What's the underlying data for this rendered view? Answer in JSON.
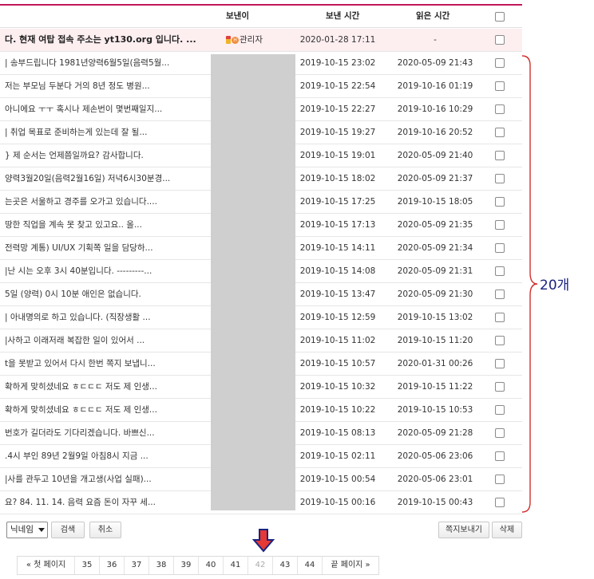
{
  "header": {
    "sender": "보낸이",
    "sent_time": "보낸 시간",
    "read_time": "읽은 시간"
  },
  "notice": {
    "subject": "다. 현재 여탑 접속 주소는 yt130.org 입니다. ...",
    "sender": "관리자",
    "sent": "2020-01-28 17:11",
    "read": "-"
  },
  "messages": [
    {
      "subject": "| 송부드립니다 1981년양력6월5일(음력5월...",
      "sent": "2019-10-15 23:02",
      "read": "2020-05-09 21:43"
    },
    {
      "subject": "저는 부모님 두분다 거의 8년 정도 병원...",
      "sent": "2019-10-15 22:54",
      "read": "2019-10-16 01:19"
    },
    {
      "subject": "아니에요 ㅜㅜ 혹시나 제손번이 몇번째일지...",
      "sent": "2019-10-15 22:27",
      "read": "2019-10-16 10:29"
    },
    {
      "subject": "| 취업 목표로 준비하는게 있는데 잘 될...",
      "sent": "2019-10-15 19:27",
      "read": "2019-10-16 20:52"
    },
    {
      "subject": "} 제 순서는 언제쯤일까요? 감사합니다.",
      "sent": "2019-10-15 19:01",
      "read": "2020-05-09 21:40"
    },
    {
      "subject": "양력3월20일(음력2월16일) 저녁6시30분경...",
      "sent": "2019-10-15 18:02",
      "read": "2020-05-09 21:37"
    },
    {
      "subject": "는곳은 서울하고 경주를 오가고 있습니다....",
      "sent": "2019-10-15 17:25",
      "read": "2019-10-15 18:05"
    },
    {
      "subject": "땅한 직업을 계속 못 찾고 있고요.. 올...",
      "sent": "2019-10-15 17:13",
      "read": "2020-05-09 21:35"
    },
    {
      "subject": "전력망 계통) UI/UX 기획쪽 일을 담당하...",
      "sent": "2019-10-15 14:11",
      "read": "2020-05-09 21:34"
    },
    {
      "subject": "|난 시는 오후 3시 40분입니다. ---------...",
      "sent": "2019-10-15 14:08",
      "read": "2020-05-09 21:31"
    },
    {
      "subject": "5일 (양력) 0시 10분 애인은 없습니다.",
      "sent": "2019-10-15 13:47",
      "read": "2020-05-09 21:30"
    },
    {
      "subject": "| 아내명의로 하고 있습니다. (직장생활 ...",
      "sent": "2019-10-15 12:59",
      "read": "2019-10-15 13:02"
    },
    {
      "subject": "|사하고 이래저래 복잡한 일이 있어서 ...",
      "sent": "2019-10-15 11:02",
      "read": "2019-10-15 11:20"
    },
    {
      "subject": "t을 못받고 있어서 다시 한번 쪽지 보냅니...",
      "sent": "2019-10-15 10:57",
      "read": "2020-01-31 00:26"
    },
    {
      "subject": "확하게 맞히셨네요 ㅎㄷㄷㄷ 저도 제 인생...",
      "sent": "2019-10-15 10:32",
      "read": "2019-10-15 11:22"
    },
    {
      "subject": "확하게 맞히셨네요 ㅎㄷㄷㄷ 저도 제 인생...",
      "sent": "2019-10-15 10:22",
      "read": "2019-10-15 10:53"
    },
    {
      "subject": "번호가 길더라도 기다리겠습니다. 바쁘신...",
      "sent": "2019-10-15 08:13",
      "read": "2020-05-09 21:28"
    },
    {
      "subject": ".4시 부인 89년 2월9일 아침8시 지금 ...",
      "sent": "2019-10-15 02:11",
      "read": "2020-05-06 23:06"
    },
    {
      "subject": "|사를 관두고 10년을 개고생(사업 실패)...",
      "sent": "2019-10-15 00:54",
      "read": "2020-05-06 23:01"
    },
    {
      "subject": "요? 84. 11. 14. 음력 요즘 돈이 자꾸 세...",
      "sent": "2019-10-15 00:16",
      "read": "2019-10-15 00:43"
    }
  ],
  "annotation": {
    "count_label": "20개",
    "brace_color": "#d32f2f",
    "label_color": "#1a237e"
  },
  "toolbar": {
    "search_field_selected": "닉네임",
    "search_button": "검색",
    "cancel_button": "취소",
    "send_message_button": "쪽지보내기",
    "delete_button": "삭제"
  },
  "pagination": {
    "first": "« 첫 페이지",
    "pages": [
      "35",
      "36",
      "37",
      "38",
      "39",
      "40",
      "41",
      "42",
      "43",
      "44"
    ],
    "current": "42",
    "last": "끝 페이지 »"
  },
  "colors": {
    "accent_border": "#c2185b",
    "notice_bg": "#fdeef0",
    "arrow_red": "#e53935",
    "arrow_outline": "#1a237e"
  }
}
